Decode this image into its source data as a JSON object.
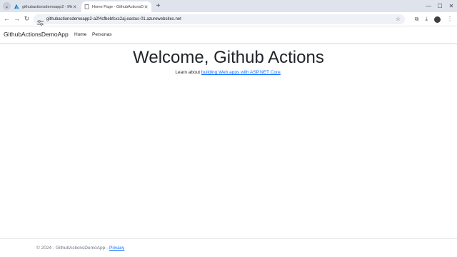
{
  "browser": {
    "tabs": [
      {
        "title": "githubactionsdemoapp2 - Micr",
        "favicon": "azure-icon",
        "active": false
      },
      {
        "title": "Home Page - GithubActionsDe",
        "favicon": "page-icon",
        "active": true
      }
    ],
    "url": "githubactionsdemoapp2-a2f4cfbebfcxc2aj.eastus-01.azurewebsites.net",
    "icons": {
      "tab_search": "chevron-down-icon",
      "new_tab": "+",
      "back": "←",
      "forward": "→",
      "reload": "↻",
      "bookmark": "☆",
      "extensions": "⧉",
      "download": "⤓",
      "menu": "⋮",
      "minimize": "—",
      "maximize": "☐",
      "close": "✕",
      "tab_close": "✕"
    }
  },
  "site": {
    "brand": "GithubActionsDemoApp",
    "nav": {
      "home": "Home",
      "personas": "Personas"
    }
  },
  "main": {
    "title": "Welcome, Github Actions",
    "subtitle_prefix": "Learn about ",
    "subtitle_link": "building Web apps with ASP.NET Core",
    "subtitle_suffix": "."
  },
  "footer": {
    "text": "© 2024 - GithubActionsDemoApp - ",
    "privacy": "Privacy"
  },
  "colors": {
    "link": "#0d6efd",
    "text": "#212529",
    "muted": "#6c757d",
    "tabstrip": "#dfe3eb",
    "omnibox": "#eef1f6"
  }
}
